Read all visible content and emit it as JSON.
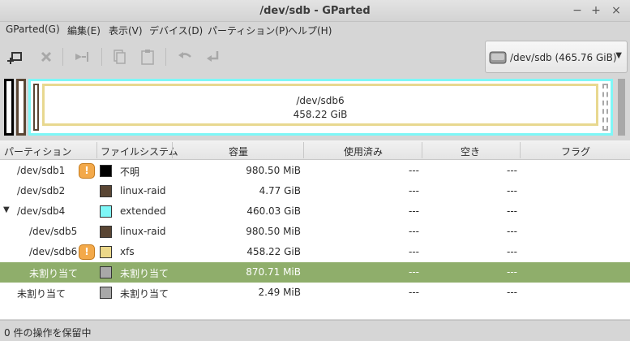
{
  "window": {
    "title": "/dev/sdb - GParted"
  },
  "menu": [
    "GParted(G)",
    "編集(E)",
    "表示(V)",
    "デバイス(D)",
    "パーティション(P)",
    "ヘルプ(H)"
  ],
  "toolbar": {
    "buttons": [
      "new-partition",
      "delete",
      "resize-move",
      "copy",
      "paste",
      "undo",
      "apply"
    ]
  },
  "device": {
    "label": "/dev/sdb  (465.76 GiB)"
  },
  "diskmap": {
    "selected_name": "/dev/sdb6",
    "selected_size": "458.22 GiB"
  },
  "columns": [
    "パーティション",
    "ファイルシステム",
    "容量",
    "使用済み",
    "空き",
    "フラグ"
  ],
  "rows": [
    {
      "partition": "/dev/sdb1",
      "fs": "不明",
      "color": "#000000",
      "size": "980.50 MiB",
      "used": "---",
      "free": "---",
      "warn": true,
      "indent": 0
    },
    {
      "partition": "/dev/sdb2",
      "fs": "linux-raid",
      "color": "#5a4634",
      "size": "4.77 GiB",
      "used": "---",
      "free": "---",
      "warn": false,
      "indent": 0
    },
    {
      "partition": "/dev/sdb4",
      "fs": "extended",
      "color": "#7ef7f7",
      "size": "460.03 GiB",
      "used": "---",
      "free": "---",
      "warn": false,
      "indent": 0,
      "expanded": true
    },
    {
      "partition": "/dev/sdb5",
      "fs": "linux-raid",
      "color": "#5a4634",
      "size": "980.50 MiB",
      "used": "---",
      "free": "---",
      "warn": false,
      "indent": 1
    },
    {
      "partition": "/dev/sdb6",
      "fs": "xfs",
      "color": "#ecd88a",
      "size": "458.22 GiB",
      "used": "---",
      "free": "---",
      "warn": true,
      "indent": 1
    },
    {
      "partition": "未割り当て",
      "fs": "未割り当て",
      "color": "#a8a8a8",
      "size": "870.71 MiB",
      "used": "---",
      "free": "---",
      "warn": false,
      "indent": 1,
      "selected": true
    },
    {
      "partition": "未割り当て",
      "fs": "未割り当て",
      "color": "#a8a8a8",
      "size": "2.49 MiB",
      "used": "---",
      "free": "---",
      "warn": false,
      "indent": 0
    }
  ],
  "status": "0 件の操作を保留中",
  "colors": {
    "selected_row": "#8fae6b",
    "extended_border": "#7ef7f7",
    "xfs": "#ecd88a"
  }
}
